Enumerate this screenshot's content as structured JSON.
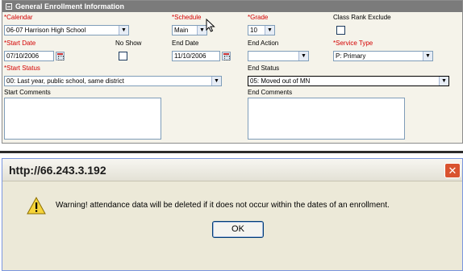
{
  "panel": {
    "title": "General Enrollment Information",
    "calendar": {
      "label": "Calendar",
      "value": "06-07 Harrison High School"
    },
    "schedule": {
      "label": "Schedule",
      "value": "Main"
    },
    "grade": {
      "label": "Grade",
      "value": "10"
    },
    "class_rank_exclude": {
      "label": "Class Rank Exclude"
    },
    "start_date": {
      "label": "Start Date",
      "value": "07/10/2006"
    },
    "no_show": {
      "label": "No Show"
    },
    "end_date": {
      "label": "End Date",
      "value": "11/10/2006"
    },
    "end_action": {
      "label": "End Action",
      "value": ""
    },
    "service_type": {
      "label": "Service Type",
      "value": "P: Primary"
    },
    "start_status": {
      "label": "Start Status",
      "value": "00: Last year, public school, same district"
    },
    "end_status": {
      "label": "End Status",
      "value": "05: Moved out of MN"
    },
    "start_comments": {
      "label": "Start Comments"
    },
    "end_comments": {
      "label": "End Comments"
    },
    "required_marker": "*"
  },
  "dialog": {
    "title": "http://66.243.3.192",
    "message": "Warning! attendance data will be deleted if it does not occur within the dates of an enrollment.",
    "ok_label": "OK",
    "close_glyph": "✕"
  },
  "colors": {
    "required": "#d40000",
    "header_bar": "#7b7b7b",
    "dialog_bg": "#ece9d8"
  }
}
